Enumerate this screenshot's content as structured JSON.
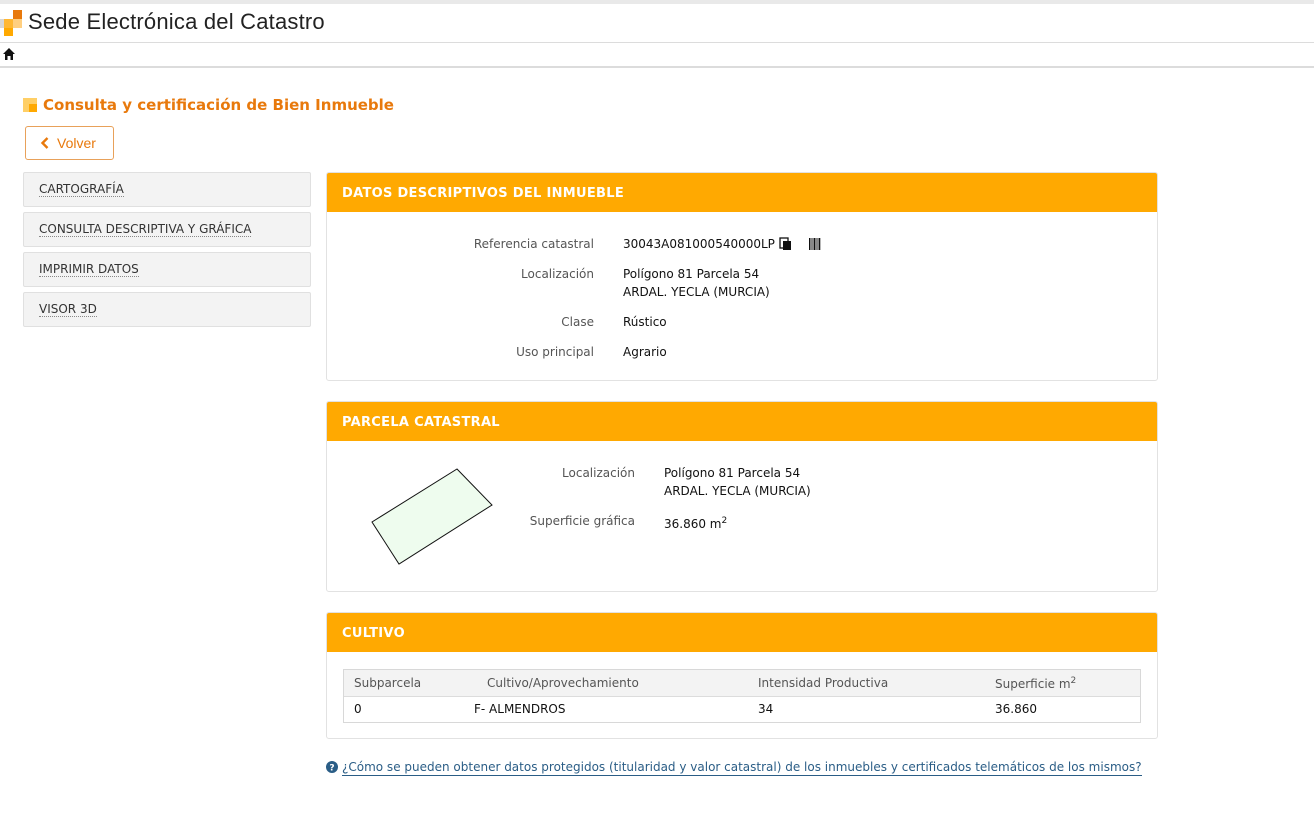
{
  "header": {
    "title": "Sede Electrónica del Catastro"
  },
  "page": {
    "title": "Consulta y certificación de Bien Inmueble",
    "back_label": "Volver"
  },
  "sidebar": {
    "items": [
      {
        "label": "CARTOGRAFÍA"
      },
      {
        "label": "CONSULTA DESCRIPTIVA Y GRÁFICA"
      },
      {
        "label": "IMPRIMIR DATOS"
      },
      {
        "label": "VISOR 3D"
      }
    ]
  },
  "datos": {
    "title": "DATOS DESCRIPTIVOS DEL INMUEBLE",
    "ref_label": "Referencia catastral",
    "ref_value": "30043A081000540000LP",
    "loc_label": "Localización",
    "loc_line1": "Polígono 81 Parcela 54",
    "loc_line2": "ARDAL. YECLA (MURCIA)",
    "clase_label": "Clase",
    "clase_value": "Rústico",
    "uso_label": "Uso principal",
    "uso_value": "Agrario"
  },
  "parcela": {
    "title": "PARCELA CATASTRAL",
    "loc_label": "Localización",
    "loc_line1": "Polígono 81 Parcela 54",
    "loc_line2": "ARDAL. YECLA (MURCIA)",
    "sup_label": "Superficie gráfica",
    "sup_value": "36.860 m",
    "sup_unit_exp": "2"
  },
  "cultivo": {
    "title": "CULTIVO",
    "headers": [
      "Subparcela",
      "Cultivo/Aprovechamiento",
      "Intensidad Productiva",
      "Superficie m"
    ],
    "header_exp": "2",
    "rows": [
      [
        "0",
        "F- ALMENDROS",
        "34",
        "36.860"
      ]
    ]
  },
  "help": {
    "link": "¿Cómo se pueden obtener datos protegidos (titularidad y valor catastral) de los inmuebles y certificados telemáticos de los mismos?"
  },
  "colors": {
    "accent": "#ffa901",
    "title_orange": "#e8790c",
    "link": "#2a5d86",
    "parcel_fill": "#eefcee"
  }
}
